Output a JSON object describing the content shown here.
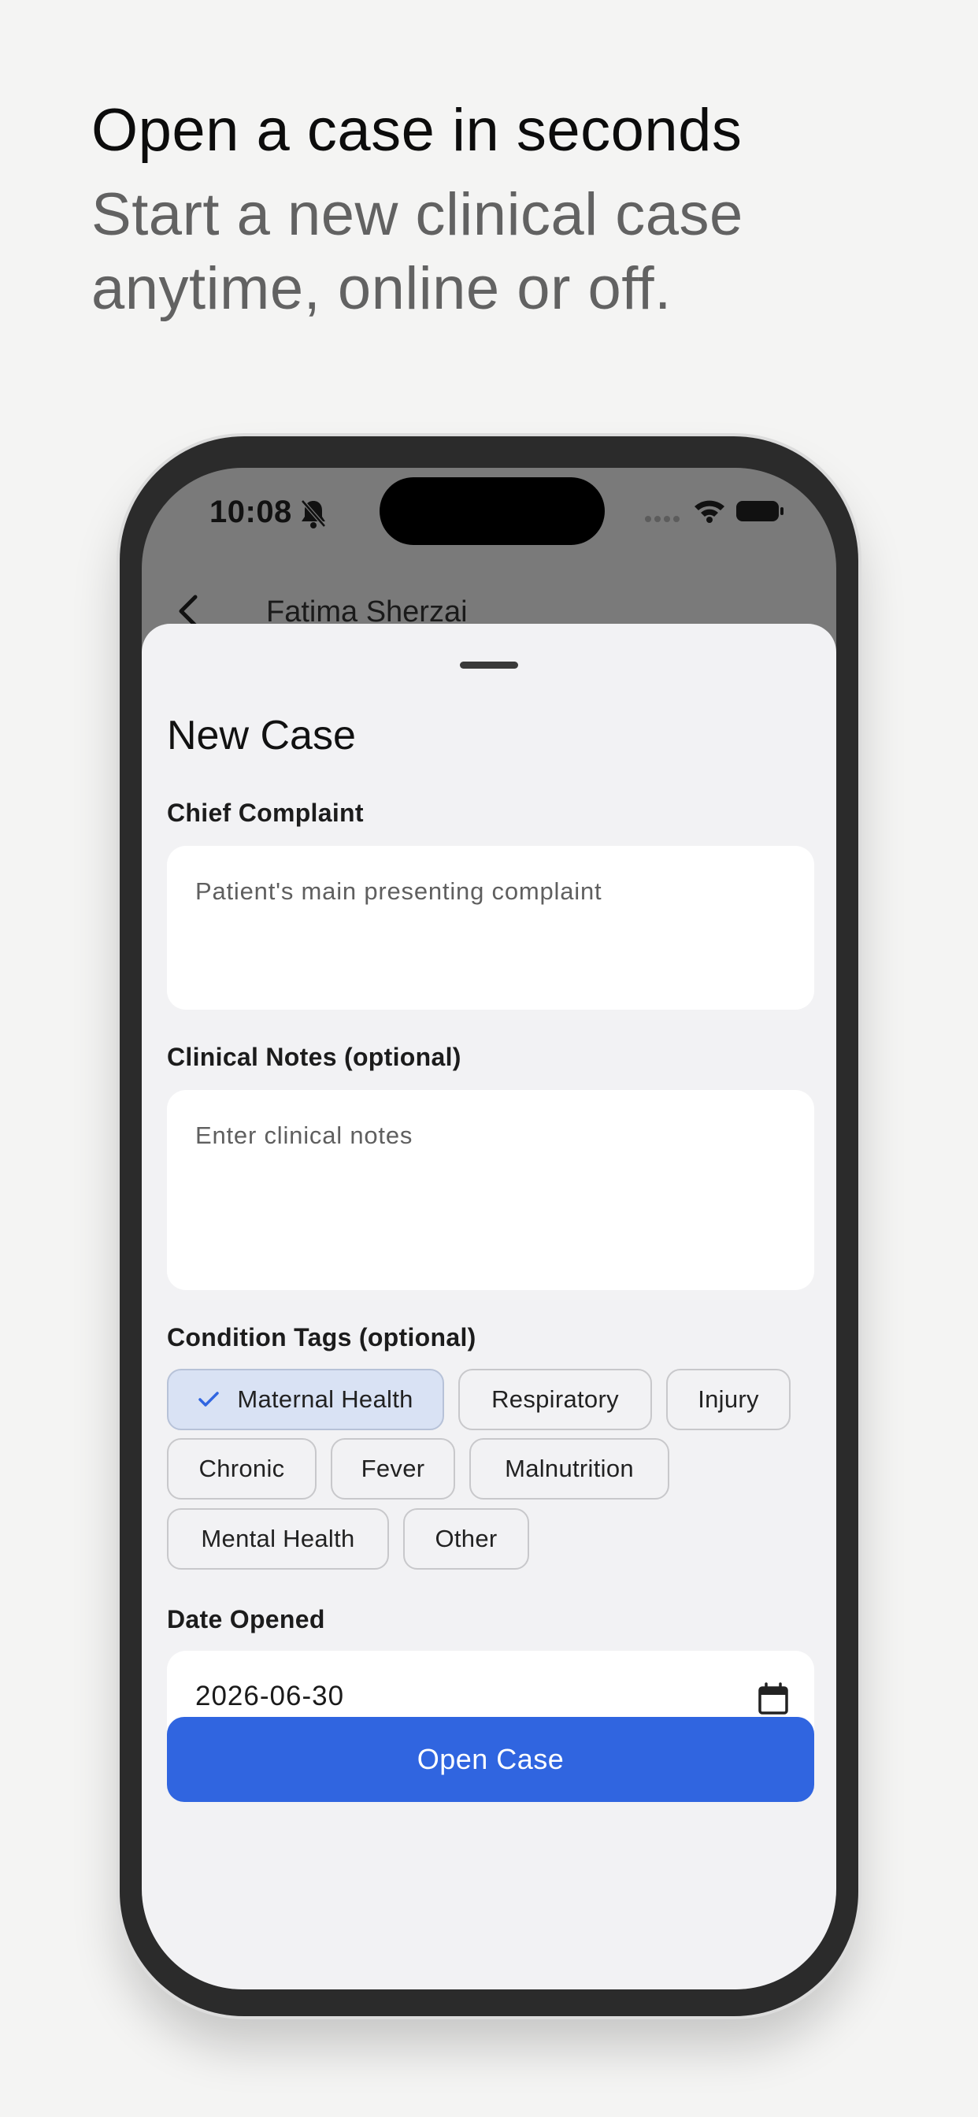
{
  "marketing": {
    "headline": "Open a case in seconds",
    "subhead": "Start a new clinical case anytime, online or off."
  },
  "status_bar": {
    "time": "10:08",
    "icons": [
      "bell-slash-icon",
      "signal-icon",
      "wifi-icon",
      "battery-icon"
    ]
  },
  "nav": {
    "back_icon": "chevron-left-icon",
    "title": "Fatima Sherzai"
  },
  "sheet": {
    "title": "New Case",
    "chief_complaint": {
      "label": "Chief Complaint",
      "placeholder": "Patient's main presenting complaint",
      "value": ""
    },
    "clinical_notes": {
      "label": "Clinical Notes (optional)",
      "placeholder": "Enter clinical notes",
      "value": ""
    },
    "condition_tags": {
      "label": "Condition Tags (optional)",
      "tags": [
        {
          "label": "Maternal Health",
          "selected": true
        },
        {
          "label": "Respiratory",
          "selected": false
        },
        {
          "label": "Injury",
          "selected": false
        },
        {
          "label": "Chronic",
          "selected": false
        },
        {
          "label": "Fever",
          "selected": false
        },
        {
          "label": "Malnutrition",
          "selected": false
        },
        {
          "label": "Mental Health",
          "selected": false
        },
        {
          "label": "Other",
          "selected": false
        }
      ]
    },
    "date_opened": {
      "label": "Date Opened",
      "value": "2026-06-30",
      "icon": "calendar-icon"
    },
    "submit_label": "Open Case"
  },
  "colors": {
    "accent": "#3065e0",
    "selected_chip": "#d9e2f4",
    "sheet_background": "#f2f2f4",
    "page_background": "#f4f4f3"
  }
}
